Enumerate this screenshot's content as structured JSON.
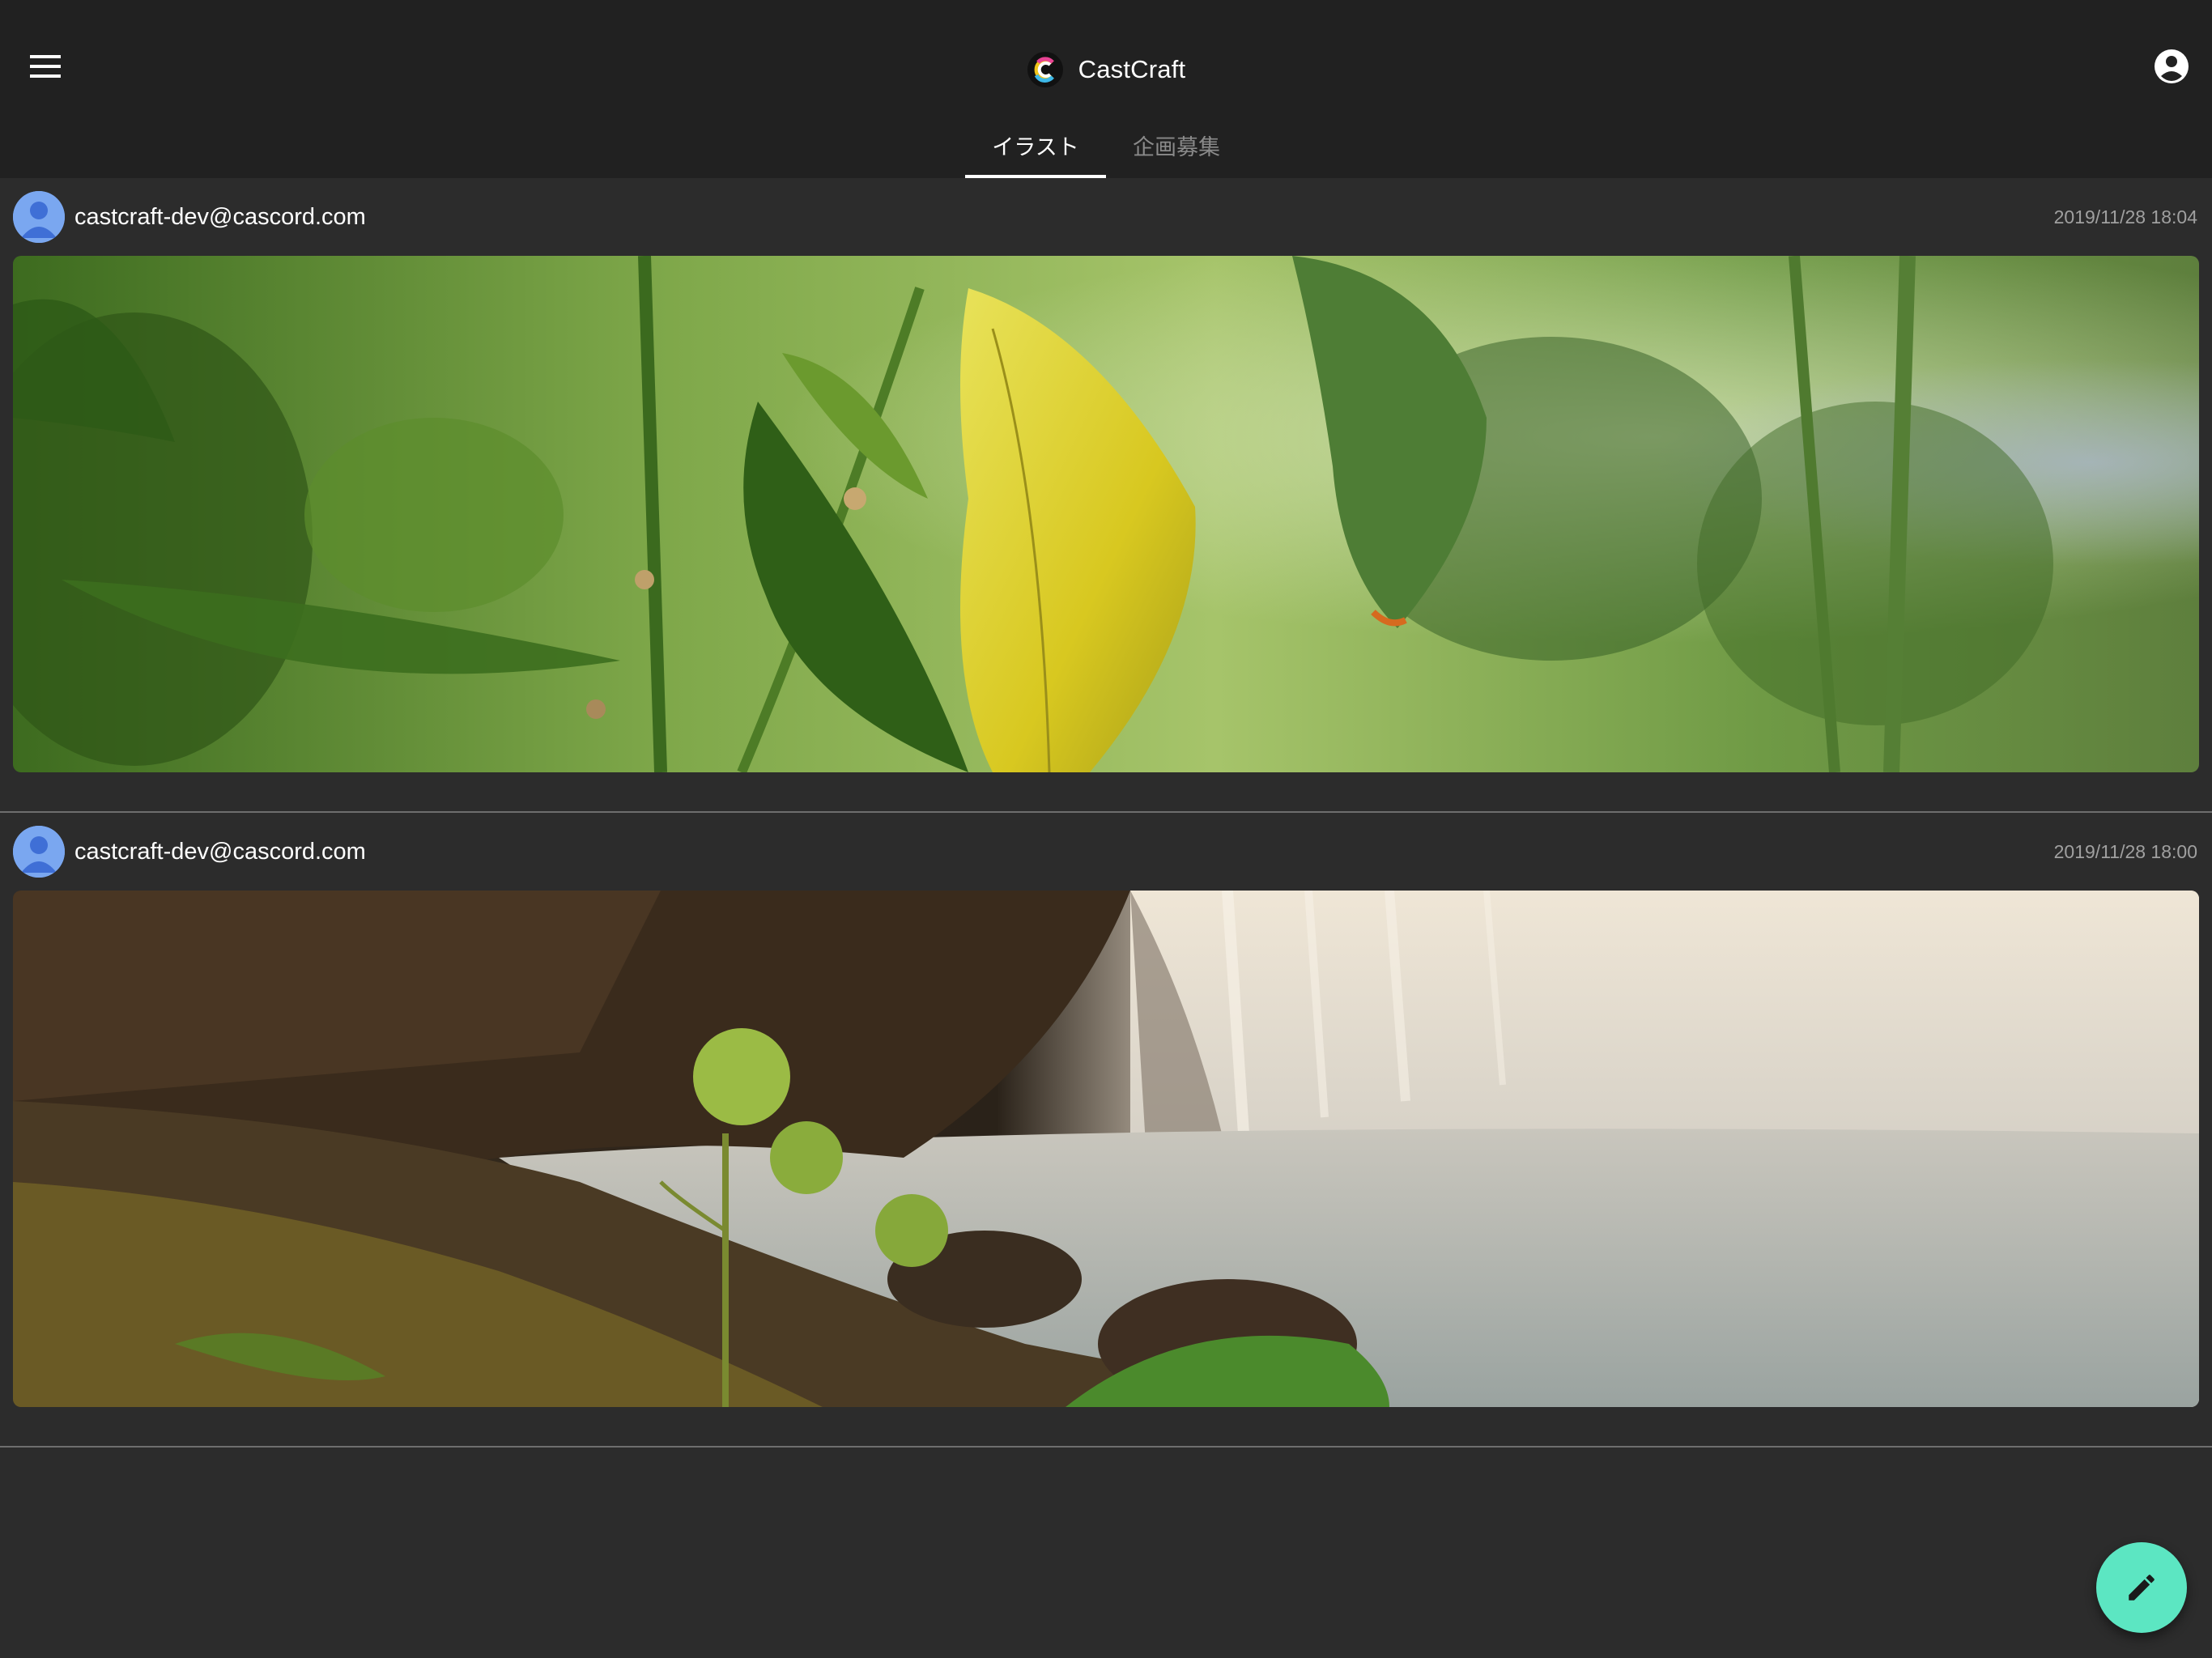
{
  "app": {
    "name": "CastCraft",
    "logo_icon": "castcraft-logo-icon",
    "menu_icon": "menu-icon",
    "account_icon": "account-circle-icon"
  },
  "tabs": [
    {
      "label": "イラスト",
      "active": true
    },
    {
      "label": "企画募集",
      "active": false
    }
  ],
  "posts": [
    {
      "author": "castcraft-dev@cascord.com",
      "timestamp": "2019/11/28 18:04",
      "image": "leaves-photo"
    },
    {
      "author": "castcraft-dev@cascord.com",
      "timestamp": "2019/11/28 18:00",
      "image": "waterfall-photo"
    }
  ],
  "fab": {
    "icon": "pencil-icon"
  },
  "colors": {
    "header_bg": "#212121",
    "page_bg": "#2c2c2c",
    "accent": "#5ce6c2",
    "avatar": "#7aa7f0"
  }
}
